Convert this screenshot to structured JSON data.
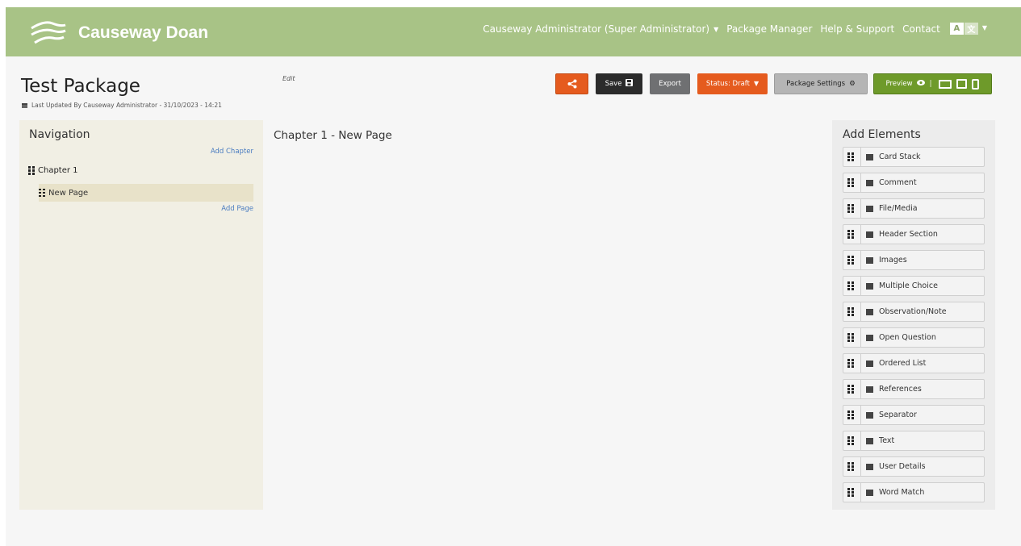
{
  "header": {
    "brand": "Causeway Doan",
    "user_menu": "Causeway Administrator (Super Administrator)",
    "links": [
      "Package Manager",
      "Help & Support",
      "Contact"
    ],
    "lang": {
      "a": "A",
      "b": "文"
    },
    "colors": {
      "bar": "#a8c386"
    }
  },
  "package": {
    "title": "Test Package",
    "updated": "Last Updated By Causeway Administrator - 31/10/2023 - 14:21",
    "edit": "Edit"
  },
  "toolbar": {
    "share_icon": "share-icon",
    "save": "Save",
    "export": "Export",
    "status": "Status: Draft",
    "settings": "Package Settings",
    "preview": "Preview",
    "colors": {
      "orange": "#e55b1e",
      "dark": "#2b2b2b",
      "grey": "#6f7072",
      "green": "#6e9a2a"
    }
  },
  "navigation": {
    "heading": "Navigation",
    "add_chapter": "Add Chapter",
    "chapter": "Chapter 1",
    "page": "New Page",
    "add_page": "Add Page"
  },
  "content": {
    "title": "Chapter 1 - New Page"
  },
  "elements": {
    "heading": "Add Elements",
    "items": [
      "Card Stack",
      "Comment",
      "File/Media",
      "Header Section",
      "Images",
      "Multiple Choice",
      "Observation/Note",
      "Open Question",
      "Ordered List",
      "References",
      "Separator",
      "Text",
      "User Details",
      "Word Match"
    ]
  }
}
